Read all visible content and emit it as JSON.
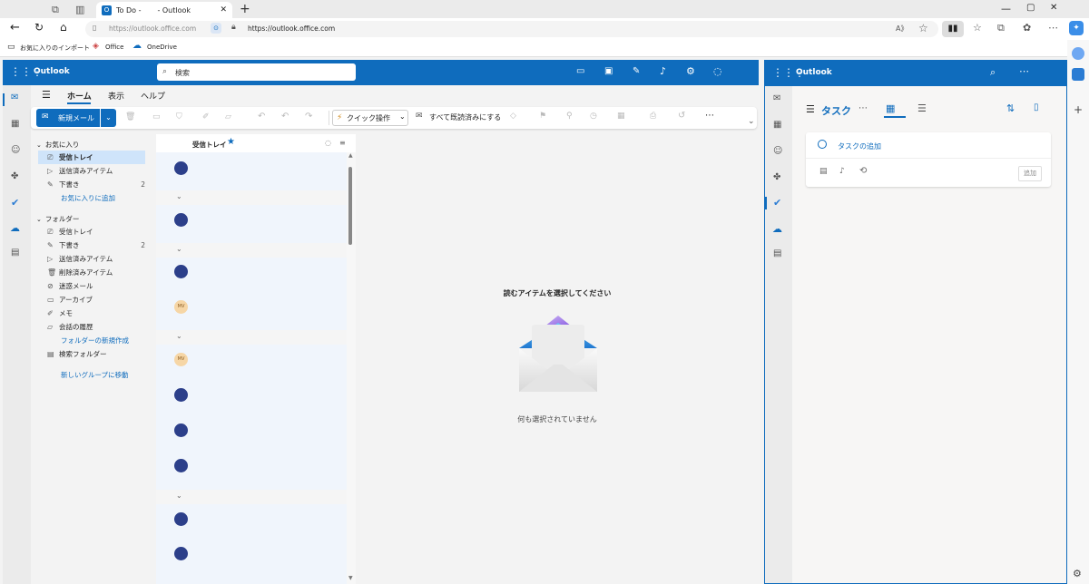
{
  "browser": {
    "tab_title": "To Do -",
    "tab_title2": "- Outlook",
    "url_display": "https://outlook.office.com",
    "url_full": "https://outlook.office.com"
  },
  "favorites": [
    {
      "label": "お気に入りのインポート"
    },
    {
      "label": "Office"
    },
    {
      "label": "OneDrive"
    }
  ],
  "header": {
    "app_name": "Outlook",
    "search_placeholder": "検索"
  },
  "ribbon": {
    "tabs": [
      "ホーム",
      "表示",
      "ヘルプ"
    ],
    "new_mail": "新規メール",
    "quick_action": "クイック操作",
    "mark_all_read": "すべて既読済みにする"
  },
  "nav": {
    "favorites_header": "お気に入り",
    "favorites": [
      {
        "label": "受信トレイ",
        "selected": true
      },
      {
        "label": "送信済みアイテム"
      },
      {
        "label": "下書き",
        "count": "2"
      }
    ],
    "add_favorite": "お気に入りに追加",
    "folders_header": "フォルダー",
    "folders": [
      {
        "label": "受信トレイ"
      },
      {
        "label": "下書き",
        "count": "2"
      },
      {
        "label": "送信済みアイテム"
      },
      {
        "label": "削除済みアイテム"
      },
      {
        "label": "迷惑メール"
      },
      {
        "label": "アーカイブ"
      },
      {
        "label": "メモ"
      },
      {
        "label": "会話の履歴"
      }
    ],
    "new_folder": "フォルダーの新規作成",
    "search_folder": "検索フォルダー",
    "new_group": "新しいグループに移動"
  },
  "msglist": {
    "title": "受信トレイ",
    "avatar_initials": "MV"
  },
  "reading": {
    "prompt": "読むアイテムを選択してください",
    "empty": "何も選択されていません"
  },
  "todo": {
    "app_name": "Outlook",
    "title": "タスク",
    "add_task": "タスクの追加",
    "add_button": "追加"
  },
  "colors": {
    "brand": "#0f6cbd",
    "avatar": "#2c3f8a",
    "selected": "#cfe4fa"
  }
}
